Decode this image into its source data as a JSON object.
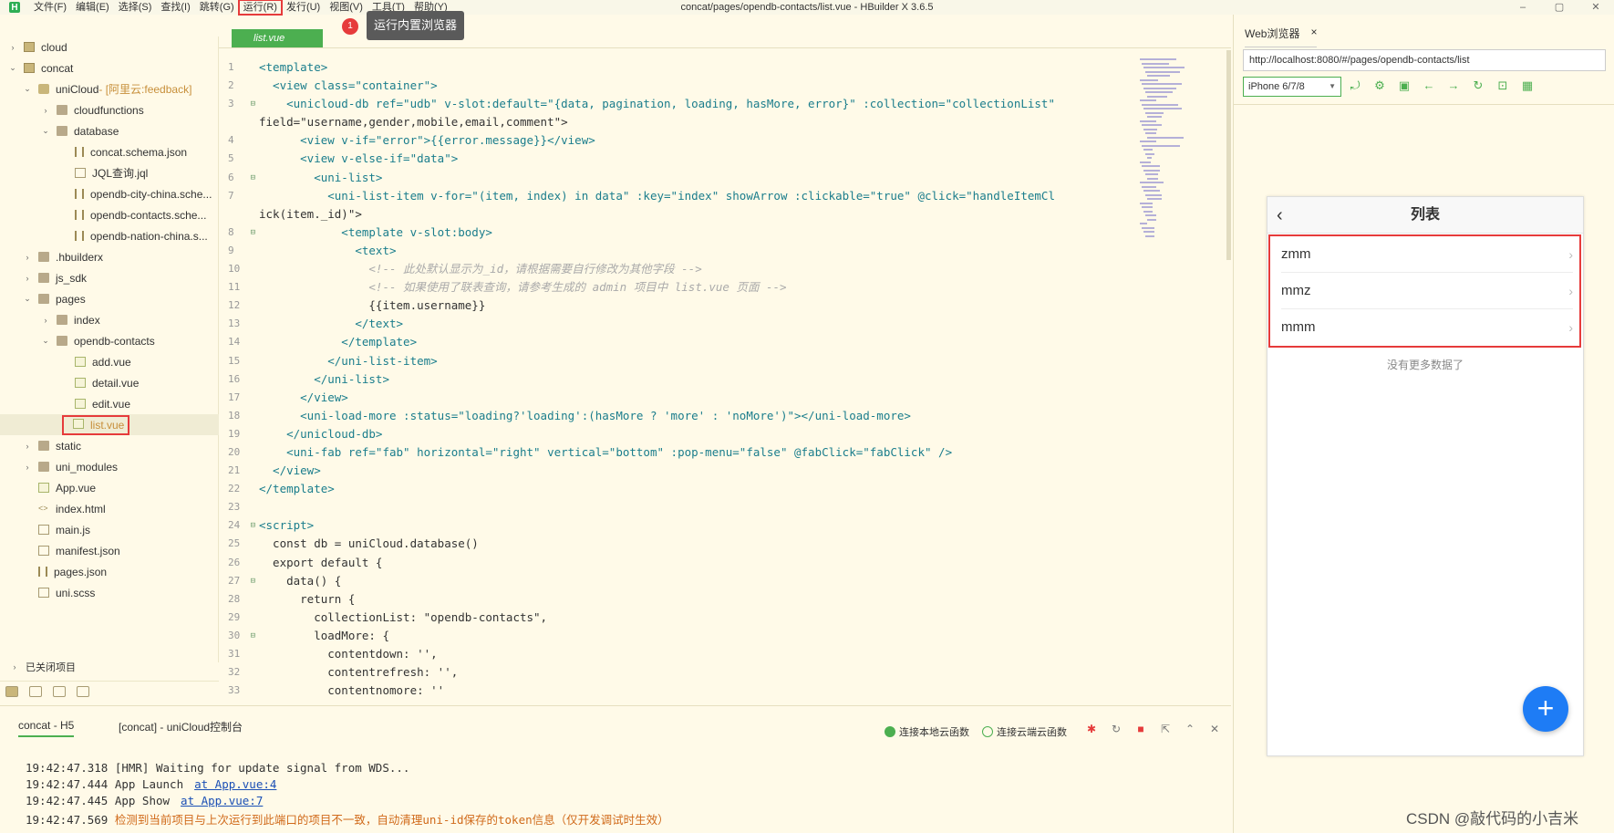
{
  "titlebar": {
    "logo": "H",
    "menu": [
      "文件(F)",
      "编辑(E)",
      "选择(S)",
      "查找(I)",
      "跳转(G)",
      "运行(R)",
      "发行(U)",
      "视图(V)",
      "工具(T)",
      "帮助(Y)"
    ],
    "window_title": "concat/pages/opendb-contacts/list.vue - HBuilder X 3.6.5",
    "minimize": "–",
    "maximize": "▢",
    "close": "✕"
  },
  "tooltip": {
    "badge": "1",
    "text": "运行内置浏览器"
  },
  "sidebar": {
    "items": [
      {
        "label": "cloud"
      },
      {
        "label": "concat"
      },
      {
        "label": "uniCloud",
        "note": " - [阿里云:feedback]"
      },
      {
        "label": "cloudfunctions"
      },
      {
        "label": "database"
      },
      {
        "label": "concat.schema.json"
      },
      {
        "label": "JQL查询.jql"
      },
      {
        "label": "opendb-city-china.sche..."
      },
      {
        "label": "opendb-contacts.sche..."
      },
      {
        "label": "opendb-nation-china.s..."
      },
      {
        "label": ".hbuilderx"
      },
      {
        "label": "js_sdk"
      },
      {
        "label": "pages"
      },
      {
        "label": "index"
      },
      {
        "label": "opendb-contacts"
      },
      {
        "label": "add.vue"
      },
      {
        "label": "detail.vue"
      },
      {
        "label": "edit.vue"
      },
      {
        "label": "list.vue"
      },
      {
        "label": "static"
      },
      {
        "label": "uni_modules"
      },
      {
        "label": "App.vue"
      },
      {
        "label": "index.html"
      },
      {
        "label": "main.js"
      },
      {
        "label": "manifest.json"
      },
      {
        "label": "pages.json"
      },
      {
        "label": "uni.scss"
      }
    ],
    "closed_projects": "已关闭项目"
  },
  "editor": {
    "tab": "list.vue",
    "line_numbers": [
      "1",
      "2",
      "3",
      "",
      "4",
      "5",
      "6",
      "7",
      "",
      "8",
      "9",
      "10",
      "11",
      "12",
      "13",
      "14",
      "15",
      "16",
      "17",
      "18",
      "19",
      "20",
      "21",
      "22",
      "23",
      "24",
      "25",
      "26",
      "27",
      "28",
      "29",
      "30",
      "31",
      "32",
      "33"
    ],
    "lines": [
      "<template>",
      "  <view class=\"container\">",
      "    <unicloud-db ref=\"udb\" v-slot:default=\"{data, pagination, loading, hasMore, error}\" :collection=\"collectionList\"",
      "field=\"username,gender,mobile,email,comment\">",
      "      <view v-if=\"error\">{{error.message}}</view>",
      "      <view v-else-if=\"data\">",
      "        <uni-list>",
      "          <uni-list-item v-for=\"(item, index) in data\" :key=\"index\" showArrow :clickable=\"true\" @click=\"handleItemCl",
      "ick(item._id)\">",
      "            <template v-slot:body>",
      "              <text>",
      "                <!-- 此处默认显示为_id，请根据需要自行修改为其他字段 -->",
      "                <!-- 如果使用了联表查询，请参考生成的 admin 项目中 list.vue 页面 -->",
      "                {{item.username}}",
      "              </text>",
      "            </template>",
      "          </uni-list-item>",
      "        </uni-list>",
      "      </view>",
      "      <uni-load-more :status=\"loading?'loading':(hasMore ? 'more' : 'noMore')\"></uni-load-more>",
      "    </unicloud-db>",
      "    <uni-fab ref=\"fab\" horizontal=\"right\" vertical=\"bottom\" :pop-menu=\"false\" @fabClick=\"fabClick\" />",
      "  </view>",
      "</template>",
      "",
      "<script>",
      "  const db = uniCloud.database()",
      "  export default {",
      "    data() {",
      "      return {",
      "        collectionList: \"opendb-contacts\",",
      "        loadMore: {",
      "          contentdown: '',",
      "          contentrefresh: '',",
      "          contentnomore: ''"
    ]
  },
  "console": {
    "tab_active": "concat - H5",
    "tab_inactive": "[concat] - uniCloud控制台",
    "radio_local": "连接本地云函数",
    "radio_cloud": "连接云端云函数",
    "lines": [
      {
        "text": "19:42:47.318 [HMR] Waiting for update signal from WDS...",
        "link": ""
      },
      {
        "text": "19:42:47.444 App Launch",
        "link": "at App.vue:4"
      },
      {
        "text": "19:42:47.445 App Show",
        "link": "at App.vue:7"
      },
      {
        "text": "19:42:47.569",
        "warn": "检测到当前项目与上次运行到此端口的项目不一致，自动清理uni-id保存的token信息（仅开发调试时生效）"
      }
    ]
  },
  "browser": {
    "tab": "Web浏览器",
    "tab_close": "×",
    "url": "http://localhost:8080/#/pages/opendb-contacts/list",
    "device": "iPhone 6/7/8"
  },
  "phone": {
    "title": "列表",
    "back": "‹",
    "items": [
      "zmm",
      "mmz",
      "mmm"
    ],
    "no_more": "没有更多数据了",
    "fab": "+"
  },
  "watermark": "CSDN @敲代码的小吉米",
  "colors": {
    "accent": "#4caf50",
    "highlight": "#e63b3b",
    "fab": "#1e7cf5"
  }
}
